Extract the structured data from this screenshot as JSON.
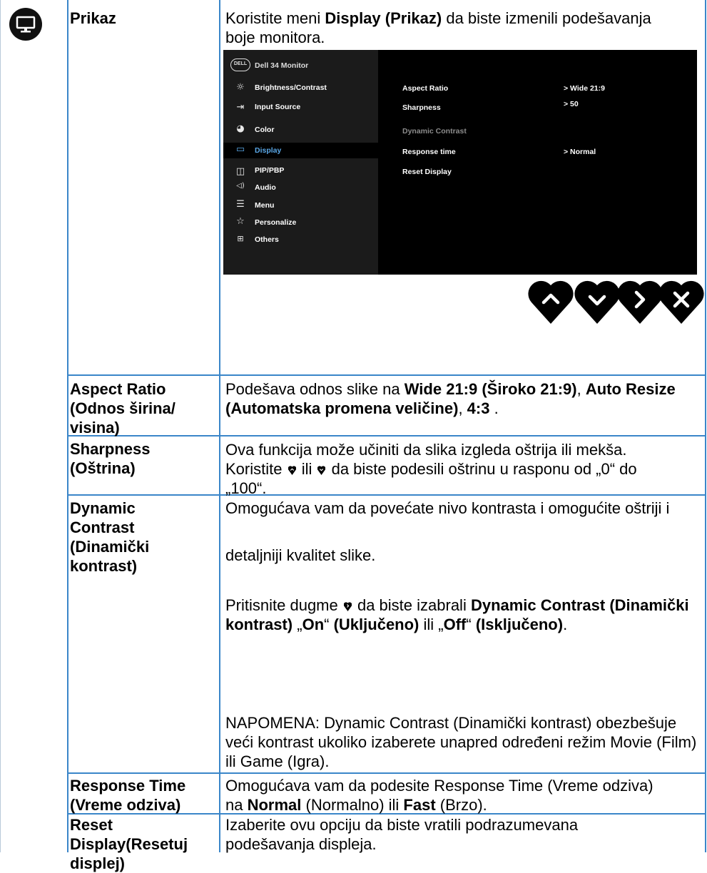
{
  "section": {
    "title": "Prikaz",
    "intro_before": "Koristite meni ",
    "intro_bold": "Display (Prikaz)",
    "intro_after": " da biste izmenili podešavanja boje monitora."
  },
  "osd": {
    "brand": "DELL",
    "model": "Dell 34 Monitor",
    "menu": [
      {
        "icon": "brightness-icon",
        "label": "Brightness/Contrast"
      },
      {
        "icon": "input-source-icon",
        "label": "Input Source"
      },
      {
        "icon": "color-icon",
        "label": "Color"
      },
      {
        "icon": "display-icon",
        "label": "Display"
      },
      {
        "icon": "pip-pbp-icon",
        "label": "PIP/PBP"
      },
      {
        "icon": "audio-icon",
        "label": "Audio"
      },
      {
        "icon": "menu-icon",
        "label": "Menu"
      },
      {
        "icon": "personalize-icon",
        "label": "Personalize"
      },
      {
        "icon": "others-icon",
        "label": "Others"
      }
    ],
    "settings": [
      {
        "label": "Aspect Ratio",
        "value": "> Wide 21:9"
      },
      {
        "label": "Sharpness",
        "value": "> 50"
      },
      {
        "label": "Dynamic Contrast",
        "value": ""
      },
      {
        "label": "Response time",
        "value": "> Normal"
      },
      {
        "label": "Reset Display",
        "value": ""
      }
    ],
    "selected_menu": "Display",
    "colors": {
      "highlight": "#5aa7e6",
      "disabled": "#8c8c8c"
    }
  },
  "nav_buttons": [
    "up-icon",
    "down-icon",
    "right-icon",
    "close-icon"
  ],
  "rows": {
    "aspect": {
      "label": "Aspect Ratio (Odnos širina/ visina)",
      "d1": "Podešava odnos slike na ",
      "b1": "Wide 21:9 (Široko 21:9)",
      "d2": ", ",
      "b2": "Auto Resize (Automatska promena veličine)",
      "d3": ", ",
      "b3": "4:3",
      "d4": " ."
    },
    "sharpness": {
      "label": "Sharpness (Oštrina)",
      "d1": "Ova funkcija može učiniti da slika izgleda oštrija ili mekša. Koristite ",
      "d2": " ili ",
      "d3": " da biste podesili oštrinu u rasponu od „0“ do „100“."
    },
    "dynamic": {
      "label": "Dynamic Contrast (Dinamički kontrast)",
      "p1": "Omogućava vam da povećate nivo kontrasta i omogućite oštriji i",
      "p2": "detaljniji kvalitet slike.",
      "p3a": "Pritisnite dugme ",
      "p3b": " da biste izabrali ",
      "p3c": "Dynamic Contrast (Dinamički kontrast)",
      "p3d": " „",
      "p3e": "On",
      "p3f": "“ ",
      "p3g": "(Uključeno)",
      "p3h": " ili „",
      "p3i": "Off",
      "p3j": "“ ",
      "p3k": "(Isključeno)",
      "p3l": ".",
      "note": "NAPOMENA: Dynamic Contrast (Dinamički kontrast) obezbešuje veći kontrast ukoliko izaberete unapred određeni režim Movie (Film) ili Game (Igra)."
    },
    "response": {
      "label1": "Response Time",
      "label2": "(Vreme odziva)",
      "d1": "Omogućava vam da podesite Response Time (Vreme odziva) na ",
      "b1": "Normal",
      "d2": " (Normalno) ili ",
      "b2": "Fast",
      "d3": " (Brzo)."
    },
    "reset": {
      "label": "Reset Display(Resetuj displej)",
      "desc": "Izaberite ovu opciju da biste vratili podrazumevana podešavanja displeja."
    }
  }
}
